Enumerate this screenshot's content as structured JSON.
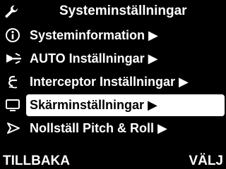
{
  "header": {
    "title": "Systeminställningar",
    "icon": "wrench-icon"
  },
  "menu": {
    "items": [
      {
        "label": "Systeminformation ▶",
        "icon": "info-icon",
        "selected": false
      },
      {
        "label": "AUTO Inställningar ▶",
        "icon": "auto-trim-icon",
        "selected": false
      },
      {
        "label": "Interceptor Inställningar ▶",
        "icon": "interceptor-icon",
        "selected": false
      },
      {
        "label": "Skärminställningar ▶",
        "icon": "monitor-icon",
        "selected": true
      },
      {
        "label": "Nollställ Pitch & Roll ▶",
        "icon": "pitch-roll-icon",
        "selected": false
      }
    ]
  },
  "footer": {
    "left_label": "TILLBAKA",
    "right_label": "VÄLJ"
  },
  "colors": {
    "background": "#000000",
    "text": "#ffffff",
    "highlight": "#ffffff",
    "highlight_text": "#000000"
  }
}
